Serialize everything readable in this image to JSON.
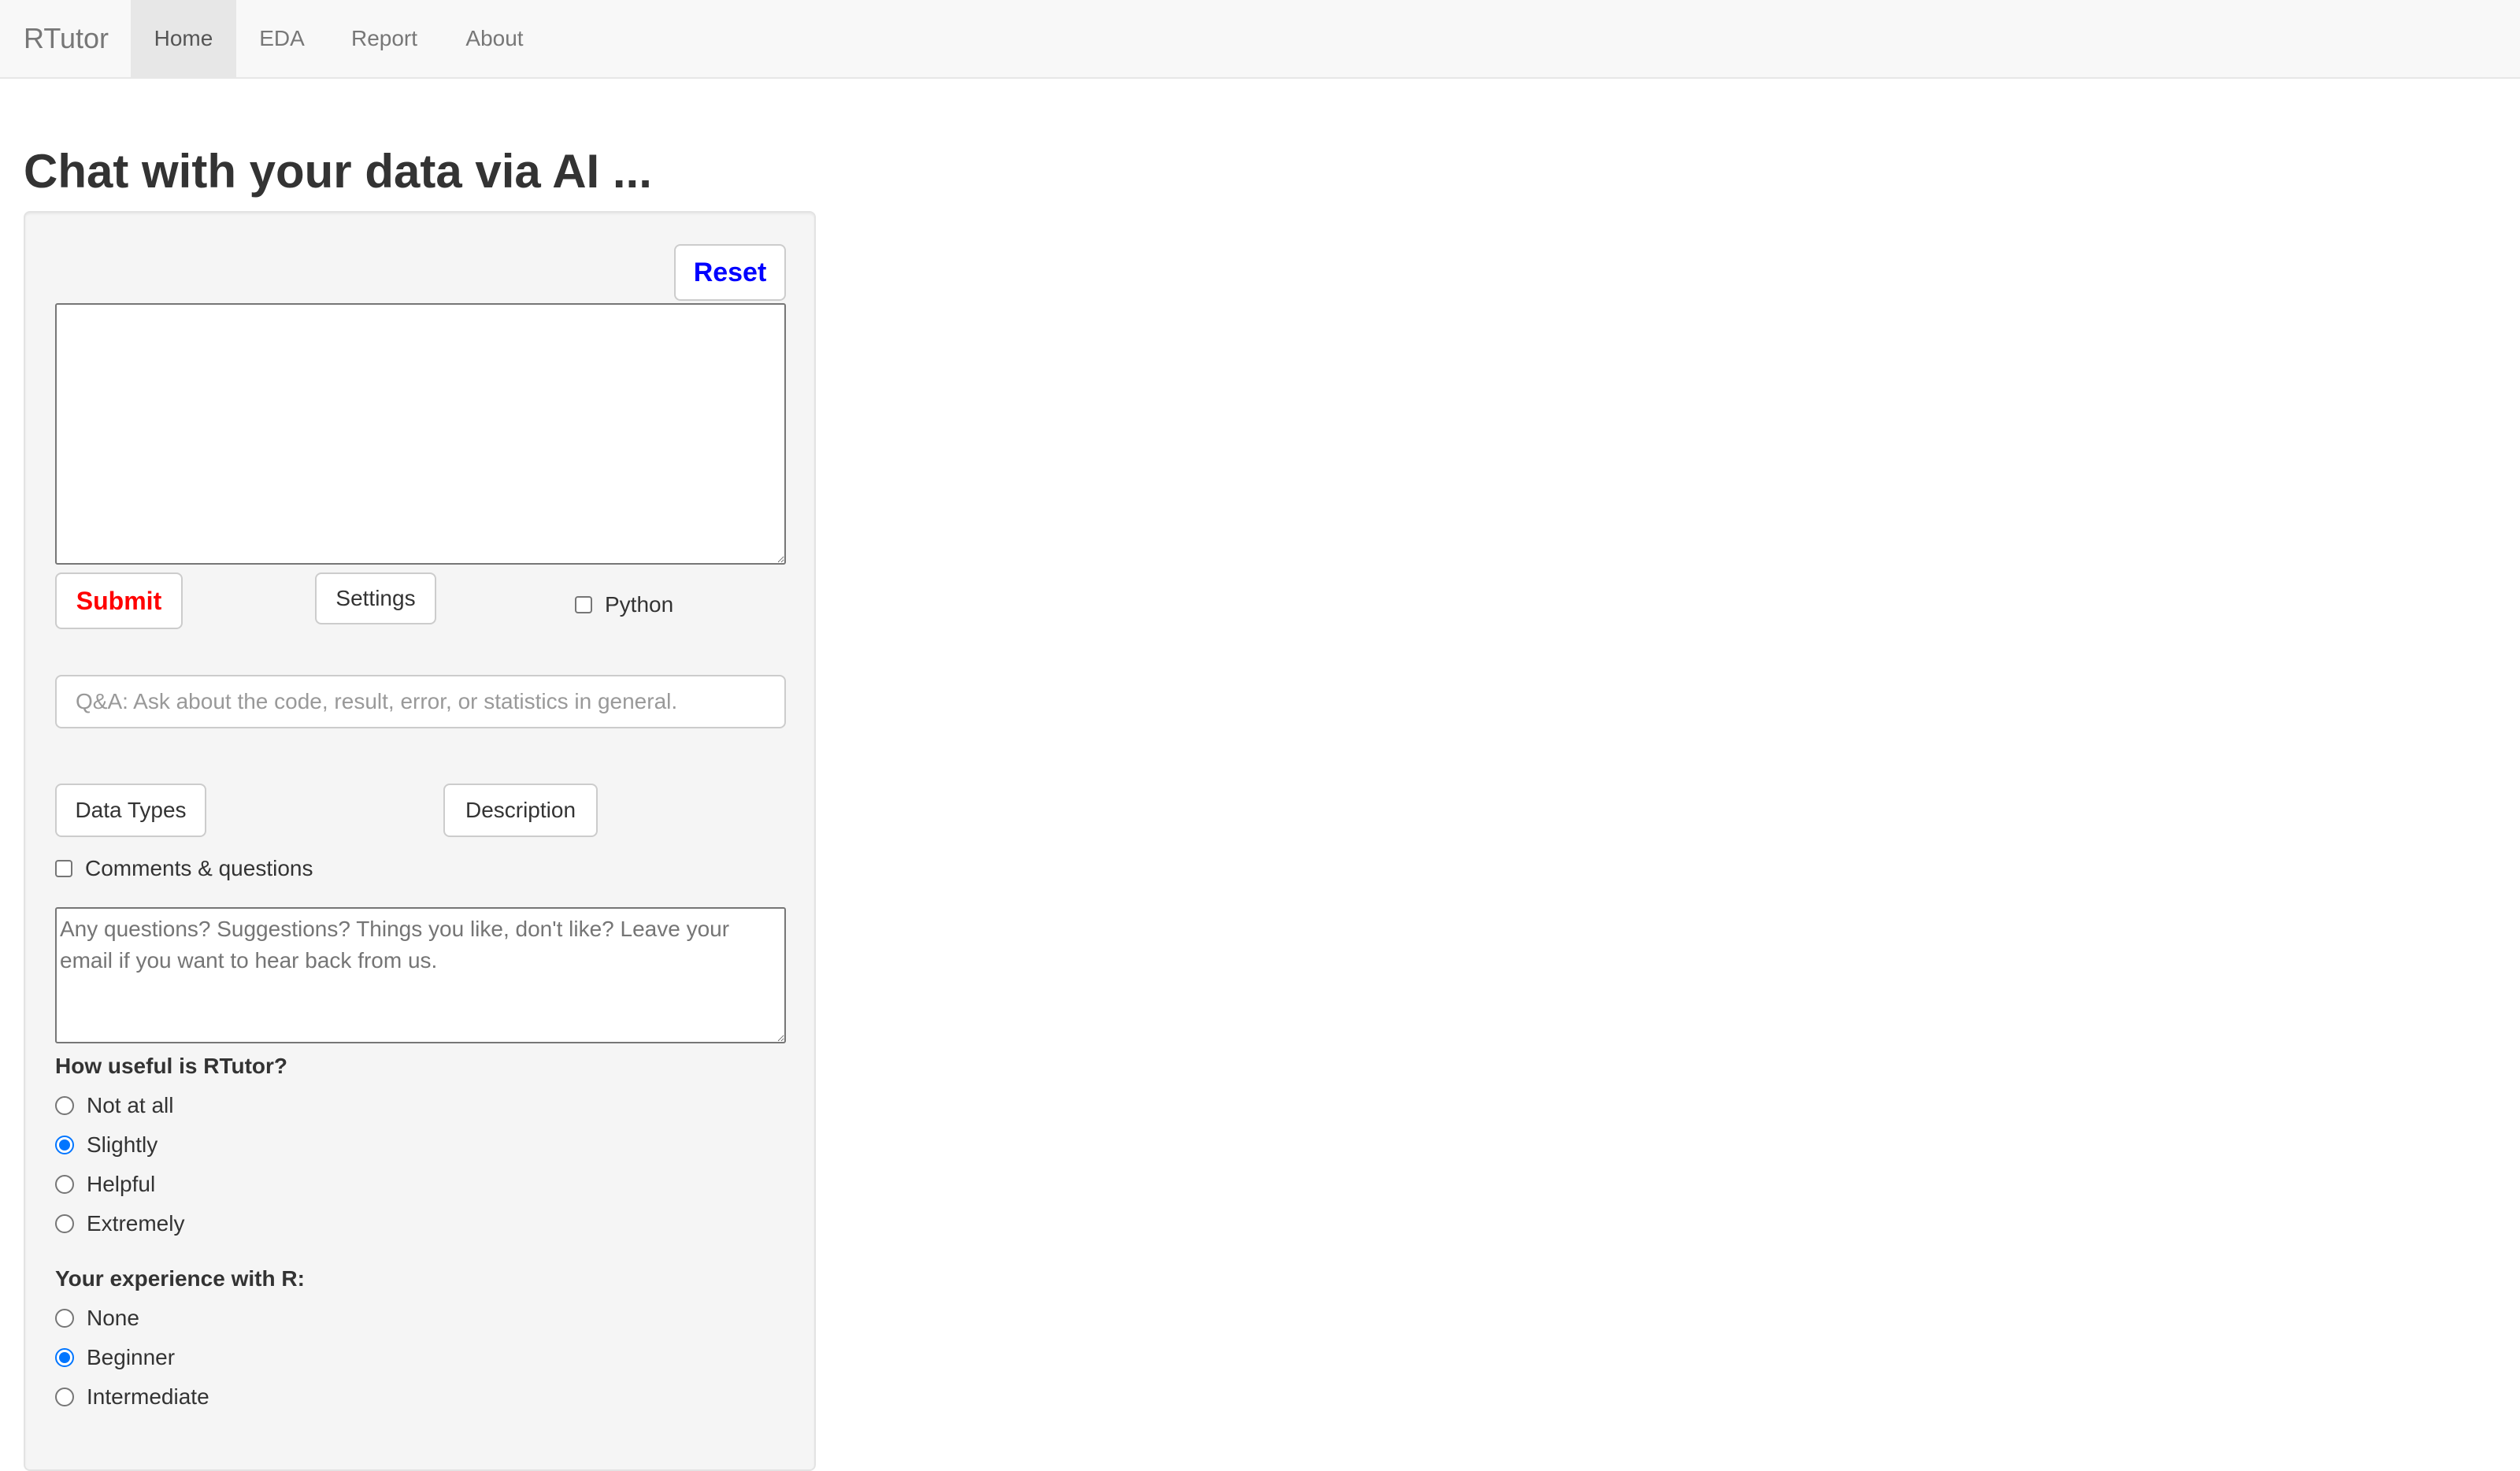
{
  "navbar": {
    "brand": "RTutor",
    "items": [
      {
        "label": "Home",
        "active": true
      },
      {
        "label": "EDA",
        "active": false
      },
      {
        "label": "Report",
        "active": false
      },
      {
        "label": "About",
        "active": false
      }
    ]
  },
  "page": {
    "title": "Chat with your data via AI ..."
  },
  "panel": {
    "reset_label": "Reset",
    "prompt": {
      "value": "",
      "placeholder": ""
    },
    "submit_label": "Submit",
    "settings_label": "Settings",
    "python_checkbox": {
      "label": "Python",
      "checked": false
    },
    "qa_input": {
      "value": "",
      "placeholder": "Q&A: Ask about the code, result, error, or statistics in general."
    },
    "data_types_label": "Data Types",
    "description_label": "Description",
    "comments_checkbox": {
      "label": "Comments & questions",
      "checked": false
    },
    "feedback": {
      "value": "",
      "placeholder": "Any questions? Suggestions? Things you like, don't like? Leave your email if you want to hear back from us."
    },
    "usefulness": {
      "label": "How useful is RTutor?",
      "options": [
        "Not at all",
        "Slightly",
        "Helpful",
        "Extremely"
      ],
      "selected": "Slightly"
    },
    "experience": {
      "label": "Your experience with R:",
      "options": [
        "None",
        "Beginner",
        "Intermediate"
      ],
      "selected": "Beginner"
    }
  },
  "colors": {
    "reset_text": "#0000ff",
    "submit_text": "#ff0000",
    "radio_checked": "#0075ff",
    "navbar_bg": "#f8f8f8",
    "nav_active_bg": "#e7e7e7",
    "panel_bg": "#f5f5f5"
  }
}
